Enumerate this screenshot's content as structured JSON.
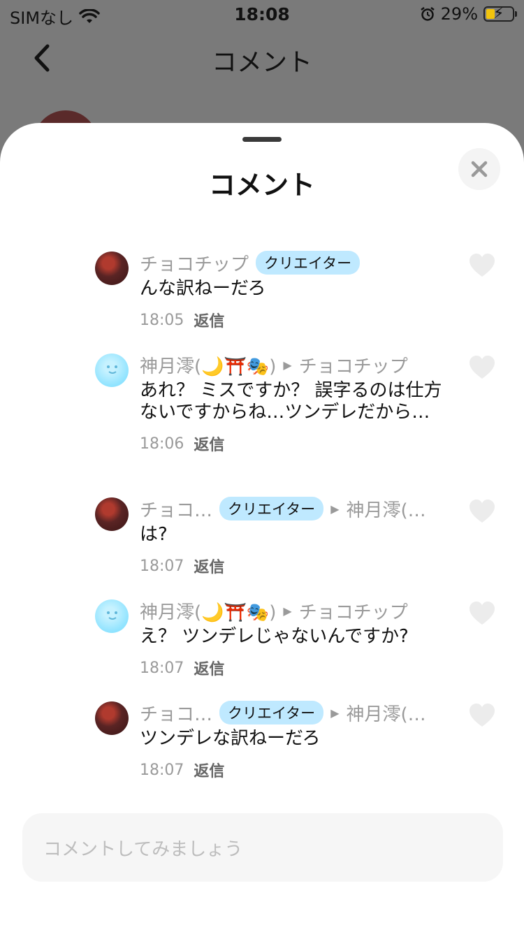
{
  "status": {
    "carrier": "SIMなし",
    "time": "18:08",
    "battery": "29%"
  },
  "header": {
    "title": "コメント"
  },
  "sheet": {
    "title": "コメント"
  },
  "comments": [
    {
      "user": "チョコチップ",
      "badge": "クリエイター",
      "reply_to": "",
      "text": "んな訳ねーだろ",
      "time": "18:05",
      "reply_label": "返信"
    },
    {
      "user": "神月澪(🌙⛩️🎭)",
      "badge": "",
      "reply_to": "チョコチップ",
      "text": "あれ？ ミスですか？ 誤字るのは仕方ないですからね…ツンデレだから…",
      "time": "18:06",
      "reply_label": "返信"
    },
    {
      "user": "チョコ…",
      "badge": "クリエイター",
      "reply_to": "神月澪(…",
      "text": "は?",
      "time": "18:07",
      "reply_label": "返信"
    },
    {
      "user": "神月澪(🌙⛩️🎭)",
      "badge": "",
      "reply_to": "チョコチップ",
      "text": "え？ ツンデレじゃないんですか?",
      "time": "18:07",
      "reply_label": "返信"
    },
    {
      "user": "チョコ…",
      "badge": "クリエイター",
      "reply_to": "神月澪(…",
      "text": "ツンデレな訳ねーだろ",
      "time": "18:07",
      "reply_label": "返信"
    }
  ],
  "input": {
    "placeholder": "コメントしてみましょう"
  }
}
